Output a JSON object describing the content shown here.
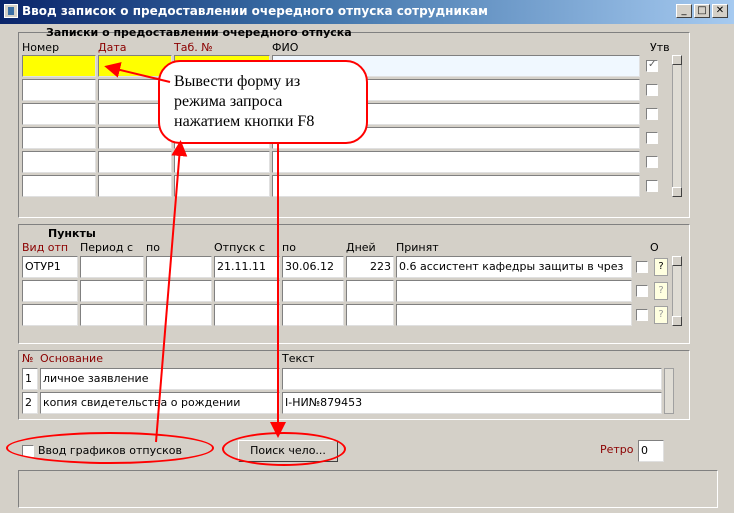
{
  "window": {
    "title": "Ввод записок о предоставлении очередного отпуска сотрудникам",
    "min": "_",
    "max": "□",
    "close": "✕"
  },
  "zapiski": {
    "section_title": "Записки о предоставлении очередного отпуска",
    "columns": {
      "number": "Номер",
      "date": "Дата",
      "tab": "Таб. №",
      "fio": "ФИО",
      "utv": "Утв"
    },
    "row1_utv_checked": true
  },
  "callout": {
    "text": "Вывести форму из режима запроса нажатием кнопки F8"
  },
  "punkty": {
    "section_title": "Пункты",
    "columns": {
      "vid": "Вид отп",
      "from": "Период с",
      "to": "по",
      "leave_from": "Отпуск с",
      "leave_to": "по",
      "days": "Дней",
      "accepted": "Принят",
      "o": "О"
    },
    "rows": [
      {
        "vid": "ОТУР1",
        "from": "",
        "to": "",
        "leave_from": "21.11.11",
        "leave_to": "30.06.12",
        "days": "223",
        "accepted": "0.6 ассистент  кафедры защиты в чрез"
      },
      {
        "vid": "",
        "from": "",
        "to": "",
        "leave_from": "",
        "leave_to": "",
        "days": "",
        "accepted": ""
      },
      {
        "vid": "",
        "from": "",
        "to": "",
        "leave_from": "",
        "leave_to": "",
        "days": "",
        "accepted": ""
      }
    ],
    "q": "?"
  },
  "osnovanie": {
    "columns": {
      "n": "№",
      "basis": "Основание",
      "text": "Текст"
    },
    "rows": [
      {
        "n": "1",
        "basis": "личное заявление",
        "text": ""
      },
      {
        "n": "2",
        "basis": "копия свидетельства о рождении",
        "text": "I-НИ№879453"
      }
    ]
  },
  "footer": {
    "schedule_label": "Ввод графиков отпусков",
    "search_button": "Поиск чело...",
    "retro_label": "Ретро",
    "retro_value": "0"
  },
  "colors": {
    "accent": "#ff0000",
    "title_bg": "#0a246a",
    "highlight": "#ffff00"
  }
}
